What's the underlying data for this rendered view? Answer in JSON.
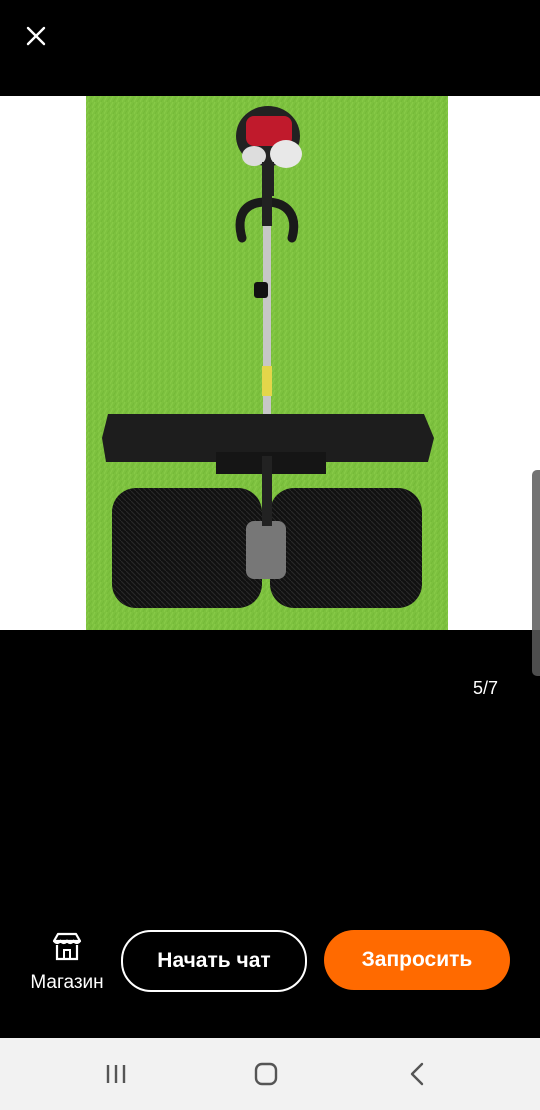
{
  "viewer": {
    "counter": "5/7"
  },
  "actions": {
    "shop_label": "Магазин",
    "chat_label": "Начать чат",
    "request_label": "Запросить"
  },
  "icons": {
    "close": "close-icon",
    "shop": "storefront-icon",
    "recents": "recent-apps-icon",
    "home": "home-icon",
    "back": "back-icon"
  },
  "colors": {
    "accent": "#ff6a00",
    "background": "#000000",
    "navbar": "#f2f2f2"
  }
}
